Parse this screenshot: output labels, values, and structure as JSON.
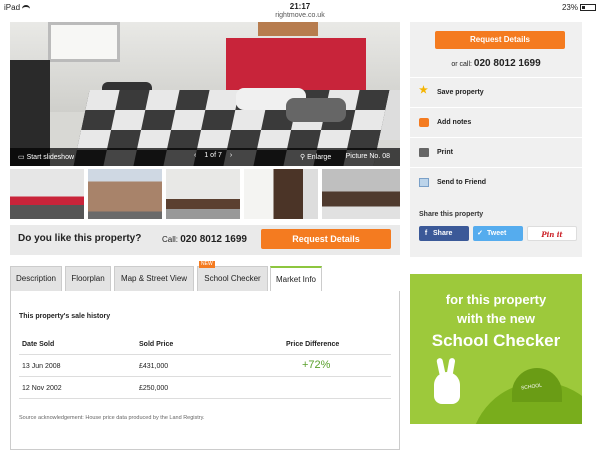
{
  "status_bar": {
    "device": "iPad",
    "time": "21:17",
    "url": "rightmove.co.uk",
    "battery": "23%"
  },
  "gallery": {
    "slideshow_label": "Start slideshow",
    "counter": "1 of 7",
    "enlarge_label": "Enlarge",
    "picture_no": "Picture No. 08"
  },
  "like_bar": {
    "question": "Do you like this property?",
    "call_prefix": "Call:",
    "phone": "020 8012 1699",
    "request_label": "Request Details"
  },
  "tabs": [
    {
      "label": "Description"
    },
    {
      "label": "Floorplan"
    },
    {
      "label": "Map & Street View"
    },
    {
      "label": "School Checker",
      "badge": "NEW"
    },
    {
      "label": "Market Info"
    }
  ],
  "sale_history": {
    "heading": "This property's sale history",
    "columns": [
      "Date Sold",
      "Sold Price",
      "Price Difference"
    ],
    "rows": [
      {
        "date": "13 Jun 2008",
        "price": "£431,000",
        "difference": "+72%"
      },
      {
        "date": "12 Nov 2002",
        "price": "£250,000",
        "difference": ""
      }
    ],
    "source": "Source acknowledgement: House price data produced by the Land Registry."
  },
  "sidebar": {
    "request_label": "Request Details",
    "or_call": "or call:",
    "phone": "020 8012 1699",
    "actions": [
      "Save property",
      "Add notes",
      "Print",
      "Send to Friend"
    ],
    "share_title": "Share this property",
    "share_facebook": "Share",
    "share_twitter": "Tweet",
    "share_pinterest": "Pin it"
  },
  "ad": {
    "line1": "for this property",
    "line2": "with the new",
    "line3": "School Checker",
    "school_label": "SCHOOL"
  },
  "colors": {
    "accent_orange": "#f47b20",
    "ad_green": "#9dc93b",
    "tab_green": "#8dc63f",
    "facebook": "#3b5998",
    "twitter": "#55acee"
  }
}
